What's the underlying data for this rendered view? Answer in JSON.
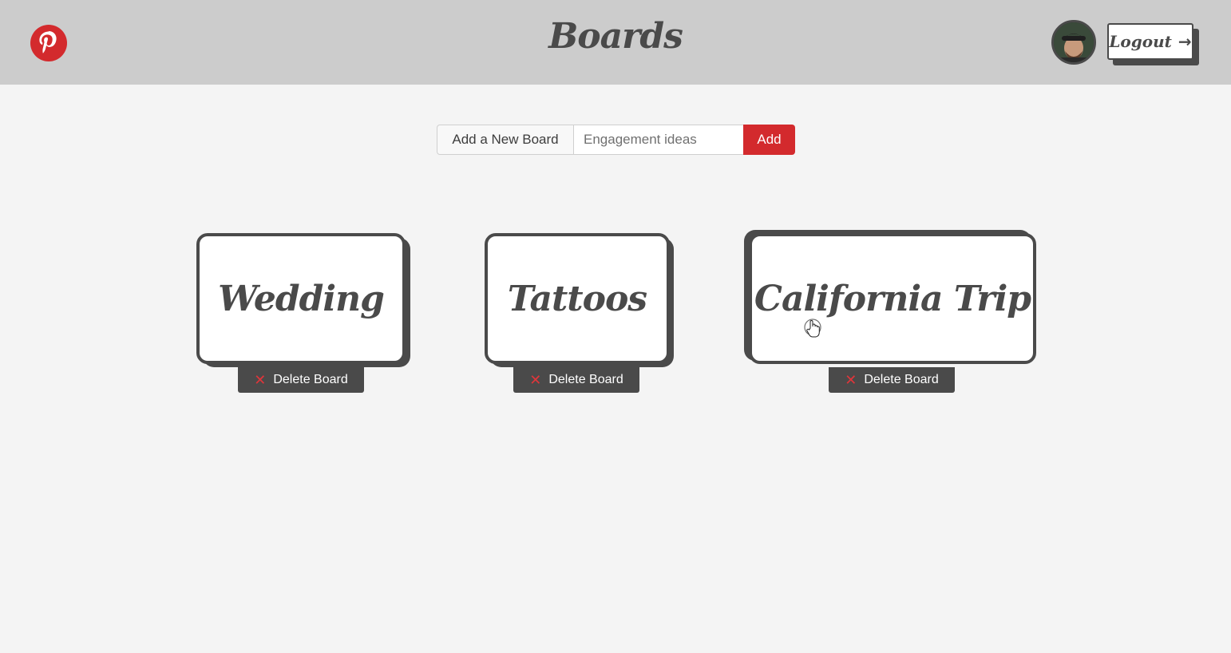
{
  "header": {
    "title": "Boards",
    "logout_label": "Logout",
    "logo_icon": "pinterest-logo",
    "brand_color": "#d32a2d"
  },
  "add_board": {
    "label": "Add a New Board",
    "input_value": "",
    "placeholder": "Engagement ideas",
    "button_label": "Add"
  },
  "boards": [
    {
      "name": "Wedding",
      "delete_label": "Delete Board"
    },
    {
      "name": "Tattoos",
      "delete_label": "Delete Board"
    },
    {
      "name": "California Trip",
      "delete_label": "Delete Board"
    }
  ]
}
